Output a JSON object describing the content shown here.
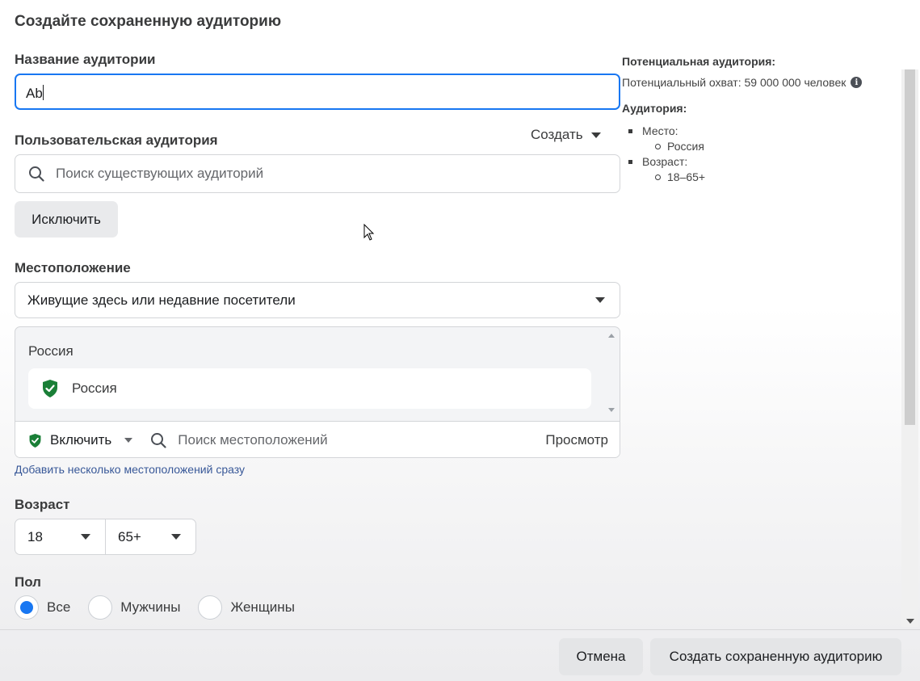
{
  "dialog": {
    "title": "Создайте сохраненную аудиторию"
  },
  "audience_name": {
    "label": "Название аудитории",
    "value": "Ab"
  },
  "custom_audience": {
    "label": "Пользовательская аудитория",
    "create_label": "Создать",
    "search_placeholder": "Поиск существующих аудиторий",
    "exclude_label": "Исключить"
  },
  "location": {
    "label": "Местоположение",
    "type_selected": "Живущие здесь или недавние посетители",
    "country_heading": "Россия",
    "selected_item": "Россия",
    "include_label": "Включить",
    "search_placeholder": "Поиск местоположений",
    "browse_label": "Просмотр",
    "bulk_add_link": "Добавить несколько местоположений сразу"
  },
  "age": {
    "label": "Возраст",
    "min": "18",
    "max": "65+"
  },
  "gender": {
    "label": "Пол",
    "options": [
      "Все",
      "Мужчины",
      "Женщины"
    ],
    "selected": "Все"
  },
  "footer": {
    "cancel_label": "Отмена",
    "create_label": "Создать сохраненную аудиторию"
  },
  "summary": {
    "potential_heading": "Потенциальная аудитория:",
    "potential_reach": "Потенциальный охват: 59 000 000 человек",
    "audience_heading": "Аудитория:",
    "place_label": "Место:",
    "place_value": "Россия",
    "age_label": "Возраст:",
    "age_value": "18–65+"
  },
  "colors": {
    "accent": "#1877f2",
    "include_green": "#1a7f37"
  }
}
